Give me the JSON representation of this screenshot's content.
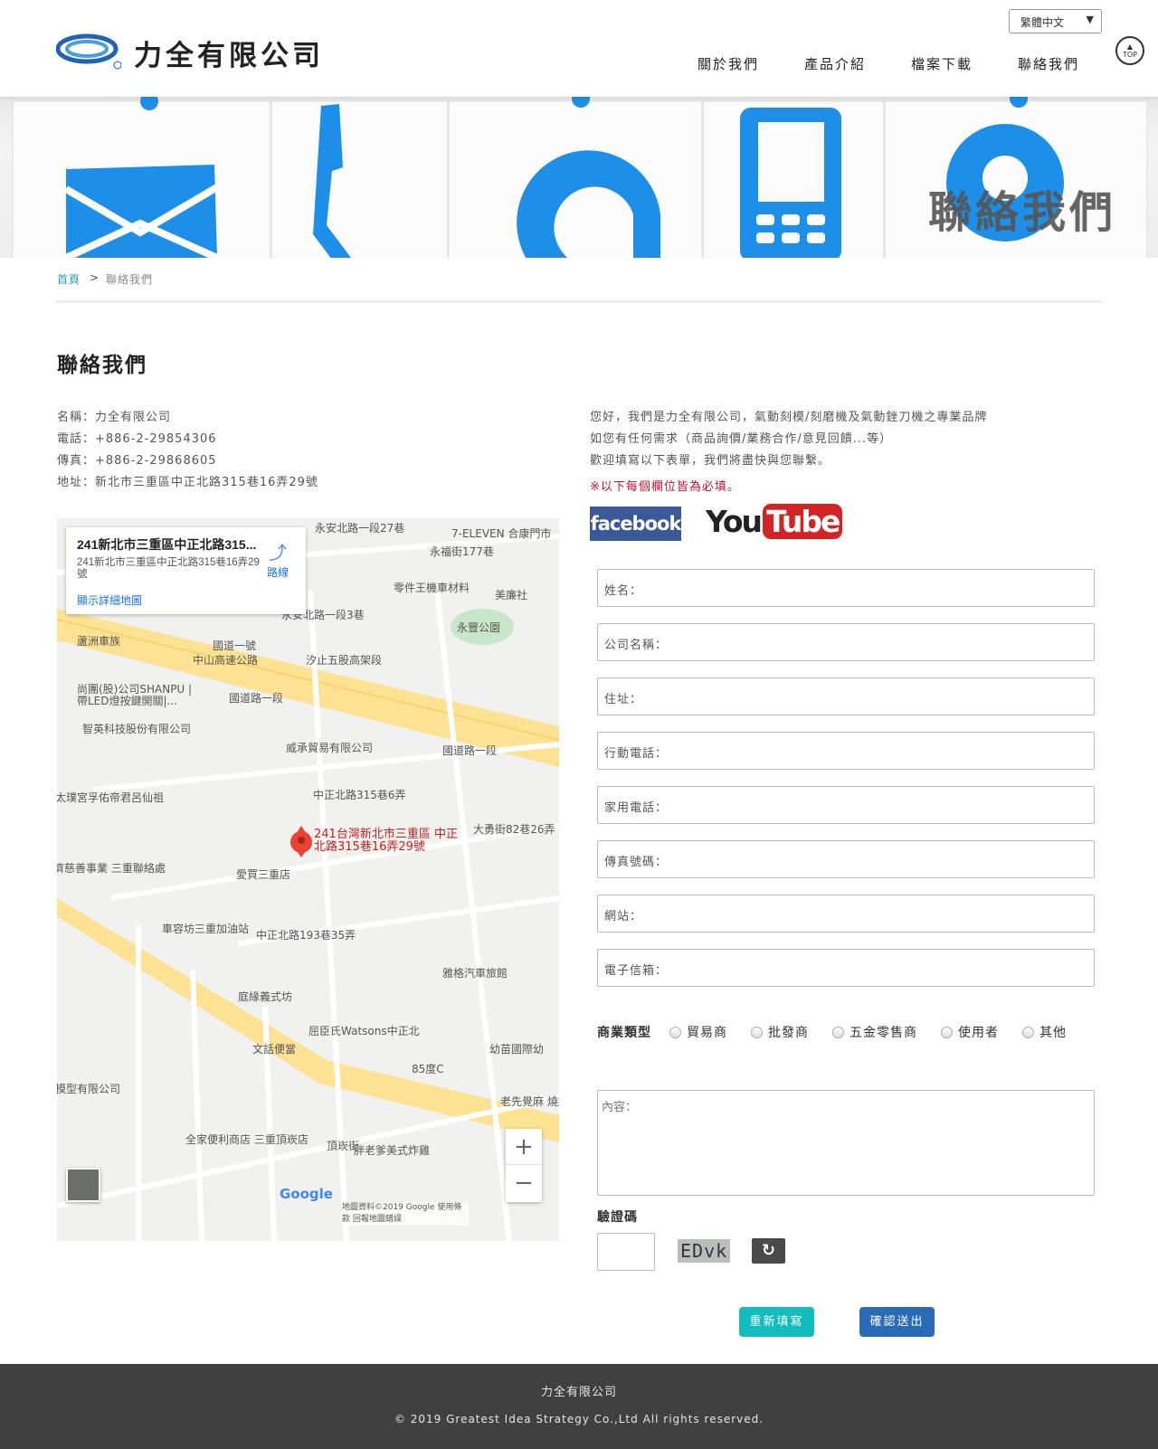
{
  "header": {
    "company_name": "力全有限公司",
    "language": "繁體中文",
    "top_label": "TOP",
    "nav": [
      {
        "label": "關於我們"
      },
      {
        "label": "產品介紹"
      },
      {
        "label": "檔案下載"
      },
      {
        "label": "聯絡我們"
      }
    ]
  },
  "banner": {
    "title": "聯絡我們"
  },
  "breadcrumb": {
    "home": "首頁",
    "separator": ">",
    "current": "聯絡我們"
  },
  "page_title": "聯絡我們",
  "info": [
    "名稱：力全有限公司",
    "電話：+886-2-29854306",
    "傳真：+886-2-29868605",
    "地址：新北市三重區中正北路315巷16弄29號"
  ],
  "intro": [
    "您好，我們是力全有限公司，氣動刻模/刻磨機及氣動銼刀機之專業品牌",
    "如您有任何需求（商品詢價/業務合作/意見回饋...等）",
    "歡迎填寫以下表單，我們將盡快與您聯繫。"
  ],
  "required_note": "※以下每個欄位皆為必填。",
  "social": {
    "facebook": "facebook",
    "youtube_you": "You",
    "youtube_tube": "Tube"
  },
  "form": {
    "fields": [
      {
        "placeholder": "姓名："
      },
      {
        "placeholder": "公司名稱："
      },
      {
        "placeholder": "住址："
      },
      {
        "placeholder": "行動電話："
      },
      {
        "placeholder": "家用電話："
      },
      {
        "placeholder": "傳真號碼："
      },
      {
        "placeholder": "網站："
      },
      {
        "placeholder": "電子信箱："
      }
    ],
    "business_type_label": "商業類型",
    "business_types": [
      "貿易商",
      "批發商",
      "五金零售商",
      "使用者",
      "其他"
    ],
    "content_placeholder": "內容：",
    "captcha_label": "驗證碼",
    "captcha_text": "EDvk",
    "reset_label": "重新填寫",
    "submit_label": "確認送出"
  },
  "map": {
    "info_title": "241新北市三重區中正北路315...",
    "info_address": "241新北市三重區中正北路315巷16弄29號",
    "directions": "路線",
    "larger_map": "顯示詳細地圖",
    "pin_label": "241台灣新北市三重區 中正北路315巷16弄29號",
    "labels": [
      "永安北路一段27巷",
      "7-ELEVEN 合康門市",
      "永福街177巷",
      "零件王機車材料",
      "美廉社",
      "永豐公園",
      "永安北路一段3巷",
      "蘆洲車族",
      "國道一號",
      "中山高速公路",
      "汐止五股高架段",
      "尚團(股)公司SHANPU | 帶LED燈按鍵開關|...",
      "國道路一段",
      "智英科技股份有限公司",
      "威承貿易有限公司",
      "國道路一段",
      "太璞宮孚佑帝君呂仙祖",
      "中正北路315巷6弄",
      "大勇街82巷26弄",
      "愛買三重店",
      "濟慈善事業 三重聯絡處",
      "車容坊三重加油站",
      "中正北路193巷35弄",
      "雅格汽車旅館",
      "庭緣義式坊",
      "屈臣氏Watsons中正北",
      "幼苗國際幼",
      "文話便當",
      "85度C",
      "老先覺麻 燒鍋三重",
      "模型有限公司",
      "全家便利商店 三重頂崁店",
      "胖老爹美式炸雞",
      "頂崁街",
      "Google",
      "地圖資料©2019 Google  使用條款  回報地圖錯誤"
    ],
    "zoom_in": "+",
    "zoom_out": "−"
  },
  "footer": {
    "company": "力全有限公司",
    "copyright": "© 2019 Greatest Idea Strategy Co.,Ltd All rights reserved."
  },
  "colors": {
    "brand_blue": "#1a8ce8",
    "teal": "#12bcbf",
    "submit_blue": "#2a6bb5",
    "required_red": "#c8102e",
    "footer_bg": "#404040"
  }
}
